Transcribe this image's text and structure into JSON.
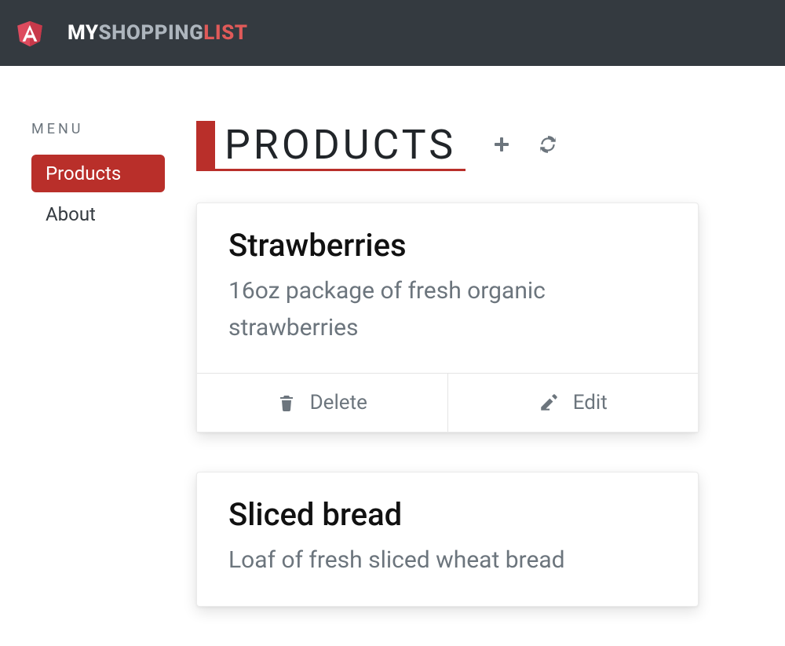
{
  "brand": {
    "part1": "MY",
    "part2": "SHOPPING",
    "part3": "LIST"
  },
  "sidebar": {
    "menu_label": "MENU",
    "items": [
      {
        "label": "Products",
        "active": true
      },
      {
        "label": "About",
        "active": false
      }
    ]
  },
  "page": {
    "title": "PRODUCTS"
  },
  "actions": {
    "delete_label": "Delete",
    "edit_label": "Edit"
  },
  "products": [
    {
      "name": "Strawberries",
      "description": "16oz package of fresh organic strawberries"
    },
    {
      "name": "Sliced bread",
      "description": "Loaf of fresh sliced wheat bread"
    }
  ]
}
